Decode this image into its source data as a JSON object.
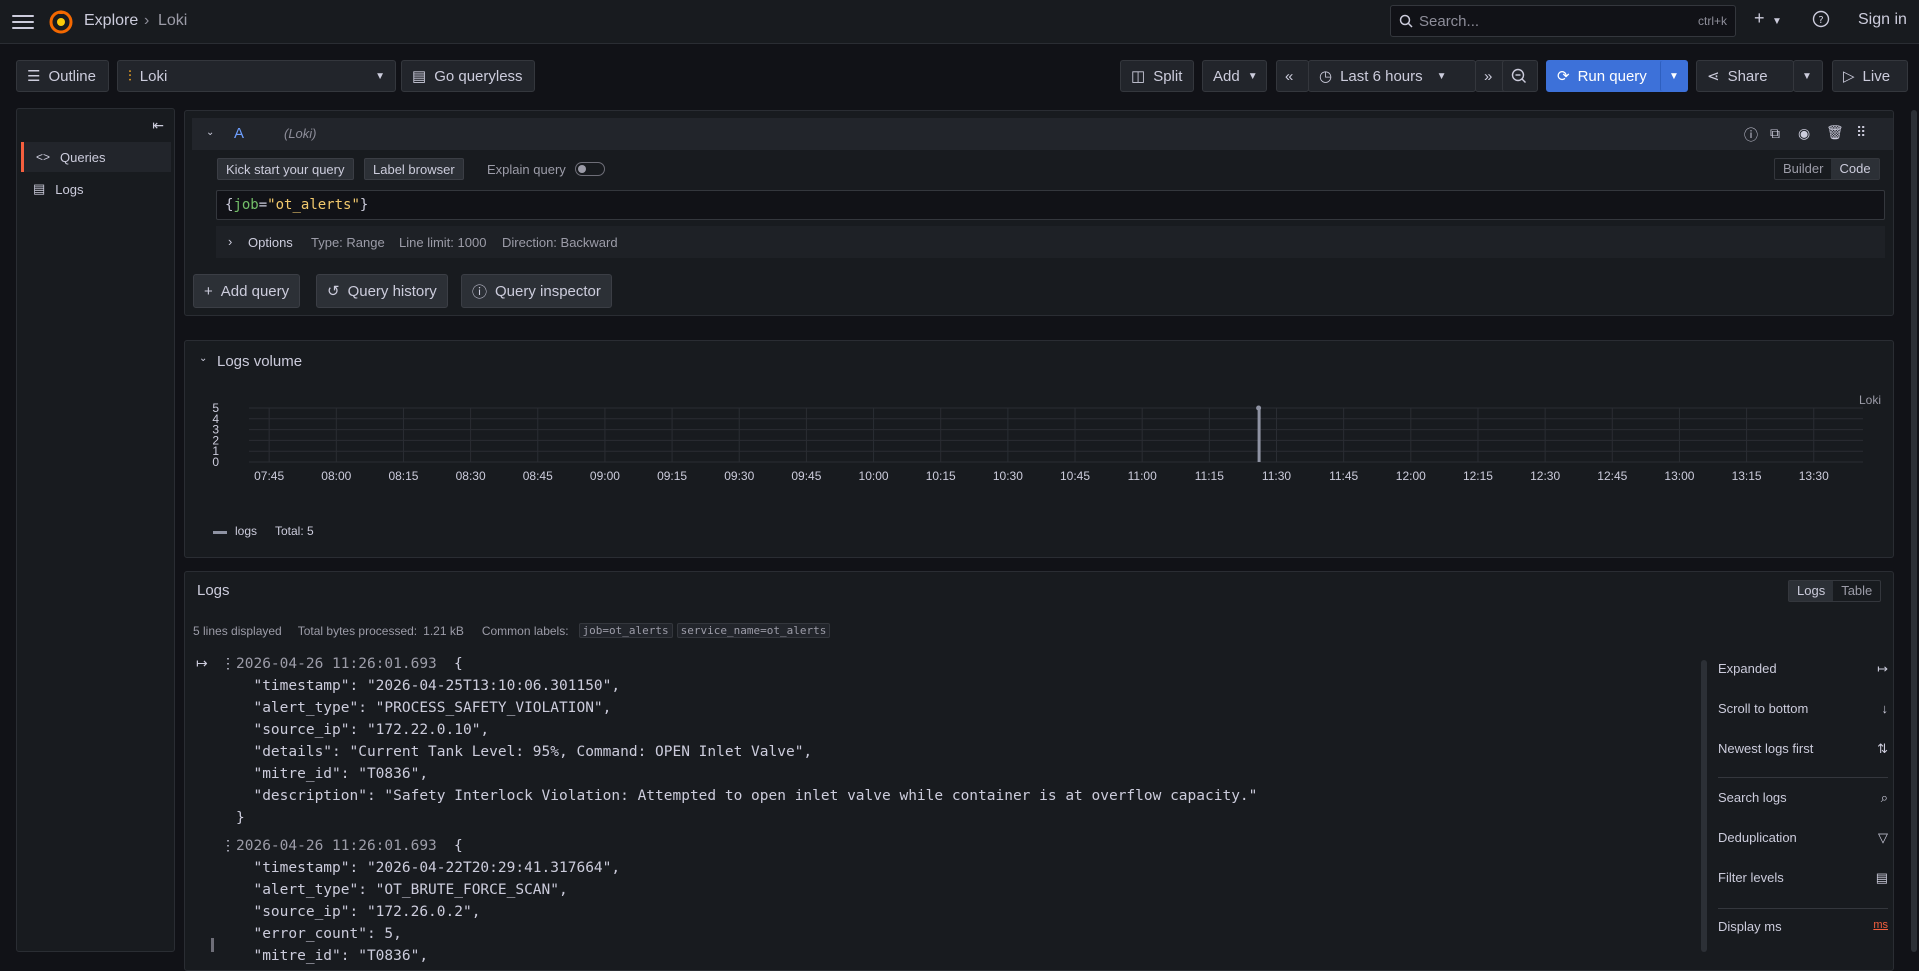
{
  "topbar": {
    "breadcrumb_explore": "Explore",
    "breadcrumb_sep": "›",
    "breadcrumb_loki": "Loki",
    "search_placeholder": "Search...",
    "search_shortcut": "ctrl+k",
    "signin": "Sign in"
  },
  "toolbar": {
    "outline": "Outline",
    "datasource": "Loki",
    "go_queryless": "Go queryless",
    "split": "Split",
    "add": "Add",
    "time_range": "Last 6 hours",
    "run_query": "Run query",
    "share": "Share",
    "live": "Live"
  },
  "sidebar": {
    "items": [
      {
        "label": "Queries",
        "icon": "code-icon",
        "active": true
      },
      {
        "label": "Logs",
        "icon": "logs-icon",
        "active": false
      }
    ]
  },
  "query": {
    "ref_id": "A",
    "datasource_hint": "(Loki)",
    "kick_start": "Kick start your query",
    "label_browser": "Label browser",
    "explain_query": "Explain query",
    "mode_builder": "Builder",
    "mode_code": "Code",
    "expr_brace_open": "{",
    "expr_key": "job",
    "expr_eq": "=",
    "expr_value": "\"ot_alerts\"",
    "expr_brace_close": "}",
    "options_label": "Options",
    "options_type": "Type: Range",
    "options_limit": "Line limit: 1000",
    "options_direction": "Direction: Backward",
    "add_query": "Add query",
    "query_history": "Query history",
    "query_inspector": "Query inspector"
  },
  "logs_volume": {
    "title": "Logs volume",
    "datasource_label": "Loki",
    "legend_name": "logs",
    "legend_total": "Total: 5"
  },
  "chart_data": {
    "type": "bar",
    "title": "",
    "xlabel": "",
    "ylabel": "",
    "ylim": [
      0,
      5
    ],
    "yticks": [
      "5",
      "4",
      "3",
      "2",
      "1",
      "0"
    ],
    "categories": [
      "07:45",
      "08:00",
      "08:15",
      "08:30",
      "08:45",
      "09:00",
      "09:15",
      "09:30",
      "09:45",
      "10:00",
      "10:15",
      "10:30",
      "10:45",
      "11:00",
      "11:15",
      "11:30",
      "11:45",
      "12:00",
      "12:15",
      "12:30",
      "12:45",
      "13:00",
      "13:15",
      "13:30"
    ],
    "series": [
      {
        "name": "logs",
        "x": [
          "11:26"
        ],
        "values": [
          5
        ],
        "color": "#8f93a3"
      }
    ],
    "grid": true,
    "legend": "bottom-left"
  },
  "logs": {
    "title": "Logs",
    "view_logs": "Logs",
    "view_table": "Table",
    "lines_displayed": "5 lines displayed",
    "bytes_label": "Total bytes processed:",
    "bytes_value": "1.21 kB",
    "common_labels_label": "Common labels:",
    "common_labels": [
      "job=ot_alerts",
      "service_name=ot_alerts"
    ],
    "entries": [
      {
        "timestamp": "2026-04-26 11:26:01.693",
        "open": "{",
        "lines": [
          "  \"timestamp\": \"2026-04-25T13:10:06.301150\",",
          "  \"alert_type\": \"PROCESS_SAFETY_VIOLATION\",",
          "  \"source_ip\": \"172.22.0.10\",",
          "  \"details\": \"Current Tank Level: 95%, Command: OPEN Inlet Valve\",",
          "  \"mitre_id\": \"T0836\",",
          "  \"description\": \"Safety Interlock Violation: Attempted to open inlet valve while container is at overflow capacity.\""
        ],
        "close": "}"
      },
      {
        "timestamp": "2026-04-26 11:26:01.693",
        "open": "{",
        "lines": [
          "  \"timestamp\": \"2026-04-22T20:29:41.317664\",",
          "  \"alert_type\": \"OT_BRUTE_FORCE_SCAN\",",
          "  \"source_ip\": \"172.26.0.2\",",
          "  \"error_count\": 5,",
          "  \"mitre_id\": \"T0836\","
        ]
      }
    ],
    "options": [
      {
        "label": "Expanded",
        "icon": "expand-icon"
      },
      {
        "label": "Scroll to bottom",
        "icon": "arrow-down-icon"
      },
      {
        "label": "Newest logs first",
        "icon": "sort-icon"
      },
      {
        "label": "Search logs",
        "icon": "search-icon"
      },
      {
        "label": "Deduplication",
        "icon": "filter-icon"
      },
      {
        "label": "Filter levels",
        "icon": "filter-levels-icon"
      },
      {
        "label": "Display ms",
        "icon": "ms-icon"
      }
    ]
  }
}
